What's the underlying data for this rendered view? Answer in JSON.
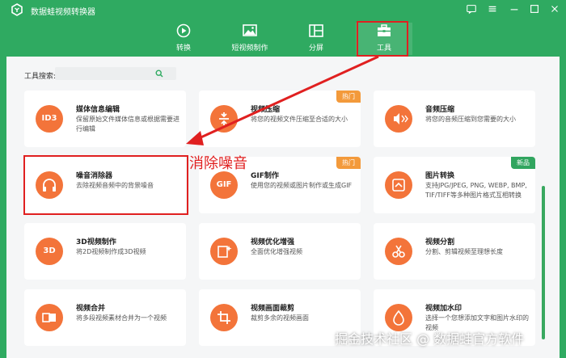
{
  "app": {
    "title": "数据蛙视频转换器"
  },
  "nav": {
    "tabs": [
      {
        "label": "转换",
        "icon": "convert-icon"
      },
      {
        "label": "短视频制作",
        "icon": "image-icon"
      },
      {
        "label": "分屏",
        "icon": "split-icon"
      },
      {
        "label": "工具",
        "icon": "toolbox-icon",
        "active": true
      }
    ]
  },
  "search": {
    "label": "工具搜索:",
    "value": "",
    "placeholder": ""
  },
  "cards": [
    {
      "title": "媒体信息编辑",
      "desc": "保留原始文件媒体信息或根据需要进行编辑",
      "icon_text": "ID3",
      "badge": ""
    },
    {
      "title": "视频压缩",
      "desc": "将您的视频文件压缩至合适的大小",
      "icon_text": "",
      "badge": "热门"
    },
    {
      "title": "音频压缩",
      "desc": "将您的音频压缩到您需要的大小",
      "icon_text": "",
      "badge": ""
    },
    {
      "title": "噪音消除器",
      "desc": "去除视频音频中的背景噪音",
      "icon_text": "",
      "badge": ""
    },
    {
      "title": "GIF制作",
      "desc": "使用您的视频或图片制作或生成GIF",
      "icon_text": "GIF",
      "badge": "热门"
    },
    {
      "title": "图片转换",
      "desc": "支持JPG/JPEG, PNG, WEBP, BMP, TIF/TIFF等多种图片格式互相转换",
      "icon_text": "",
      "badge": "新品"
    },
    {
      "title": "3D视频制作",
      "desc": "将2D视频制作成3D视频",
      "icon_text": "3D",
      "badge": ""
    },
    {
      "title": "视频优化增强",
      "desc": "全面优化增强视频",
      "icon_text": "",
      "badge": ""
    },
    {
      "title": "视频分割",
      "desc": "分割、剪辑视频至理想长度",
      "icon_text": "",
      "badge": ""
    },
    {
      "title": "视频合并",
      "desc": "将多段视频素材合并为一个视频",
      "icon_text": "",
      "badge": ""
    },
    {
      "title": "视频画面裁剪",
      "desc": "裁剪多余的视频画面",
      "icon_text": "",
      "badge": ""
    },
    {
      "title": "视频加水印",
      "desc": "选择一个您想添加文字和图片水印的视频",
      "icon_text": "",
      "badge": ""
    }
  ],
  "annotation": {
    "text": "消除噪音"
  },
  "watermark": {
    "text": "掘金技术社区 @ 数据蛙官方软件"
  },
  "colors": {
    "brand": "#2faa61",
    "icon": "#f3743a",
    "hot": "#f39a3b",
    "new": "#31a55f",
    "annotation": "#e02020"
  }
}
